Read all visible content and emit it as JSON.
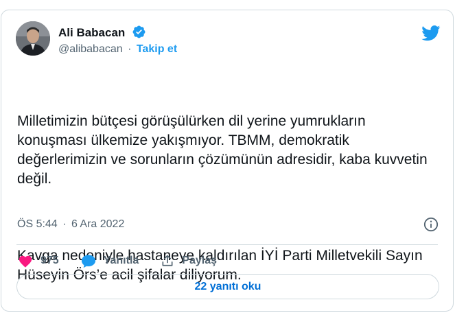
{
  "author": {
    "name": "Ali Babacan",
    "handle": "@alibabacan",
    "separator": "·",
    "follow_label": "Takip et",
    "verified_icon": "verified-badge-icon"
  },
  "tweet": {
    "paragraphs": [
      "Milletimizin bütçesi görüşülürken dil yerine yumrukların konuşması ülkemize yakışmıyor. TBMM, demokratik değerlerimizin ve sorunların çözümünün adresidir, kaba kuvvetin değil.",
      "Kavga nedeniyle hastaneye kaldırılan İYİ Parti Milletvekili Sayın Hüseyin Örs’e acil şifalar diliyorum."
    ],
    "time": "ÖS 5:44",
    "separator": "·",
    "date": "6 Ara 2022"
  },
  "actions": {
    "like_count": "975",
    "reply_label": "Yanıtla",
    "share_label": "Paylaş"
  },
  "replies_button": "22 yanıtı oku",
  "colors": {
    "accent": "#1d9bf0",
    "like": "#f91880",
    "link_dark": "#006fd6",
    "muted": "#536471",
    "border": "#cfd9de"
  },
  "icons": [
    "twitter-bird-icon",
    "info-icon",
    "heart-icon",
    "reply-bubble-icon",
    "share-icon"
  ]
}
